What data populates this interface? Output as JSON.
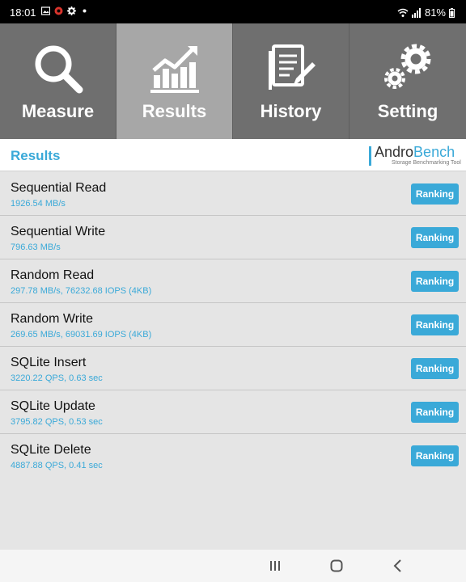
{
  "status_bar": {
    "time": "18:01",
    "notification_icons": [
      "image-icon",
      "app-icon",
      "gear-icon",
      "dot-icon"
    ],
    "battery_level": "81%",
    "signal_icons": [
      "wifi-icon",
      "signal-icon",
      "battery-icon"
    ]
  },
  "tabs": [
    {
      "label": "Measure",
      "icon": "magnifier-icon",
      "active": false
    },
    {
      "label": "Results",
      "icon": "chart-icon",
      "active": true
    },
    {
      "label": "History",
      "icon": "document-edit-icon",
      "active": false
    },
    {
      "label": "Setting",
      "icon": "gears-icon",
      "active": false
    }
  ],
  "header": {
    "title": "Results",
    "brand_name_part1": "Andro",
    "brand_name_part2": "Bench",
    "brand_tagline": "Storage Benchmarking Tool"
  },
  "results": [
    {
      "title": "Sequential Read",
      "value": "1926.54 MB/s",
      "button": "Ranking"
    },
    {
      "title": "Sequential Write",
      "value": "796.63 MB/s",
      "button": "Ranking"
    },
    {
      "title": "Random Read",
      "value": "297.78 MB/s, 76232.68 IOPS (4KB)",
      "button": "Ranking"
    },
    {
      "title": "Random Write",
      "value": "269.65 MB/s, 69031.69 IOPS (4KB)",
      "button": "Ranking"
    },
    {
      "title": "SQLite Insert",
      "value": "3220.22 QPS, 0.63 sec",
      "button": "Ranking"
    },
    {
      "title": "SQLite Update",
      "value": "3795.82 QPS, 0.53 sec",
      "button": "Ranking"
    },
    {
      "title": "SQLite Delete",
      "value": "4887.88 QPS, 0.41 sec",
      "button": "Ranking"
    }
  ],
  "colors": {
    "accent": "#3aa9d8",
    "tab_bar": "#6f6f6f",
    "tab_active": "#a7a7a7",
    "background": "#e5e5e5"
  },
  "nav_bar": {
    "buttons": [
      "recent-apps-icon",
      "home-icon",
      "back-icon"
    ]
  }
}
